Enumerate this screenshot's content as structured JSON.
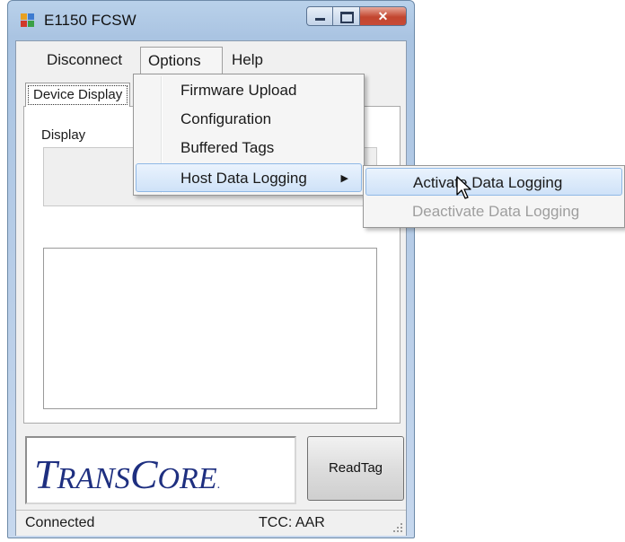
{
  "window": {
    "title": "E1150 FCSW"
  },
  "menubar": {
    "items": [
      "Disconnect",
      "Options",
      "Help"
    ]
  },
  "tab": {
    "label": "Device Display"
  },
  "panel": {
    "display_label": "Display",
    "display_value": "",
    "text_area_value": ""
  },
  "options_menu": {
    "items": [
      "Firmware Upload",
      "Configuration",
      "Buffered Tags",
      "Host Data Logging"
    ]
  },
  "host_data_logging_submenu": {
    "items": [
      "Activate Data Logging",
      "Deactivate Data Logging"
    ]
  },
  "logo": {
    "text_big_t": "T",
    "text_rans": "RANS",
    "text_big_c": "C",
    "text_ore": "ORE",
    "mark": "."
  },
  "buttons": {
    "read_tag": "ReadTag"
  },
  "statusbar": {
    "left": "Connected",
    "right": "TCC: AAR"
  },
  "colors": {
    "logo": "#1e2f80",
    "highlight": "#cfe2f8",
    "close_button": "#c2462f"
  },
  "icons": [
    "app-icon",
    "minimize-icon",
    "maximize-icon",
    "close-icon",
    "submenu-arrow-icon",
    "mouse-cursor-icon",
    "resize-grip-icon"
  ]
}
